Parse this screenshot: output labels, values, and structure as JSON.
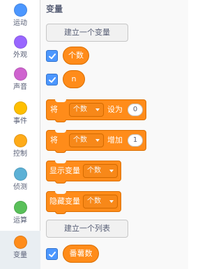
{
  "sidebar": {
    "items": [
      {
        "label": "运动",
        "color": "#4c97ff"
      },
      {
        "label": "外观",
        "color": "#9966ff"
      },
      {
        "label": "声音",
        "color": "#cf63cf"
      },
      {
        "label": "事件",
        "color": "#ffbf00"
      },
      {
        "label": "控制",
        "color": "#ffab19"
      },
      {
        "label": "侦测",
        "color": "#5cb1d6"
      },
      {
        "label": "运算",
        "color": "#59c059"
      },
      {
        "label": "变量",
        "color": "#ff8c1a",
        "selected": true
      }
    ]
  },
  "palette": {
    "title": "变量",
    "make_variable_button": "建立一个变量",
    "variables": [
      {
        "name": "个数",
        "checked": true
      },
      {
        "name": "n",
        "checked": true
      }
    ],
    "blocks": {
      "set": {
        "prefix": "将",
        "variable": "个数",
        "verb": "设为",
        "value": "0"
      },
      "change": {
        "prefix": "将",
        "variable": "个数",
        "verb": "增加",
        "value": "1"
      },
      "show": {
        "label": "显示变量",
        "variable": "个数"
      },
      "hide": {
        "label": "隐藏变量",
        "variable": "个数"
      }
    },
    "make_list_button": "建立一个列表",
    "lists": [
      {
        "name": "番薯数",
        "checked": true
      }
    ]
  },
  "colors": {
    "variables_block": "#ff8c1a",
    "variables_block_border": "#db6e00",
    "checkbox": "#4c97ff",
    "text": "#575e75"
  }
}
